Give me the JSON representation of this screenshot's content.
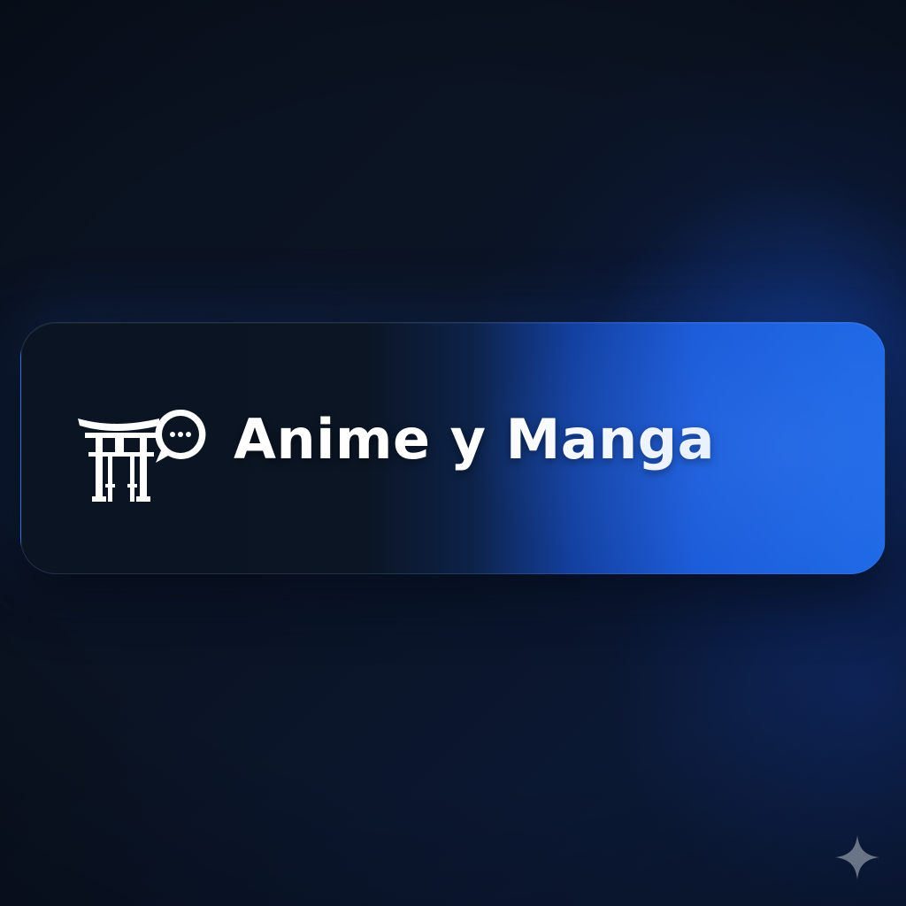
{
  "banner": {
    "title": "Anime y Manga",
    "logo_icon": "torii-gate-chat-bubble-icon",
    "accent_color": "#1d68e6",
    "background_color": "#0b1422"
  },
  "corner_mark": {
    "icon": "sparkle-icon"
  }
}
